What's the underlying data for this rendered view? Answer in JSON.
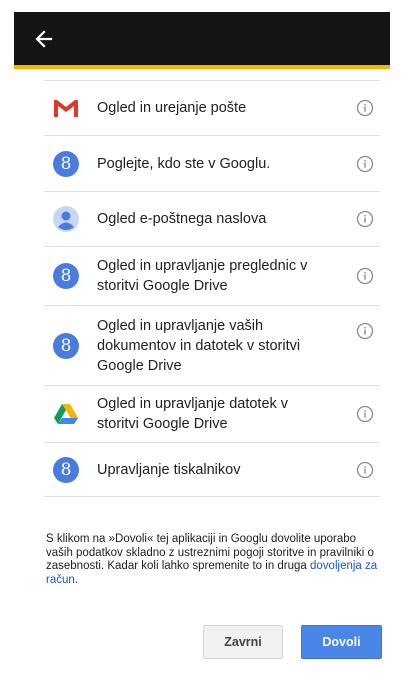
{
  "header": {
    "back_icon": "arrow-left-icon",
    "background": "#141414",
    "accent": "#f2b705"
  },
  "permissions": [
    {
      "icon": "gmail-icon",
      "label": "Ogled in urejanje pošte"
    },
    {
      "icon": "google-plus-icon",
      "label": "Poglejte, kdo ste v Googlu."
    },
    {
      "icon": "person-icon",
      "label": "Ogled e-poštnega naslova"
    },
    {
      "icon": "google-plus-icon",
      "label": "Ogled in upravljanje preglednic v storitvi Google Drive"
    },
    {
      "icon": "google-plus-icon",
      "label": "Ogled in upravljanje vaših dokumentov in datotek v storitvi Google Drive"
    },
    {
      "icon": "google-drive-icon",
      "label": "Ogled in upravljanje datotek v storitvi Google Drive"
    },
    {
      "icon": "google-plus-icon",
      "label": "Upravljanje tiskalnikov"
    }
  ],
  "consent": {
    "text": "S klikom na »Dovoli« tej aplikaciji in Googlu dovolite uporabo vaših podatkov skladno z ustreznimi pogoji storitve in pravilniki o zasebnosti. Kadar koli lahko spremenite to in druga ",
    "link_text": "dovoljenja za račun",
    "suffix": "."
  },
  "buttons": {
    "cancel_label": "Zavrni",
    "allow_label": "Dovoli"
  },
  "colors": {
    "allow_button": "#4a86e8",
    "link": "#1a55c8",
    "google_blue": "#4a7ce0"
  }
}
